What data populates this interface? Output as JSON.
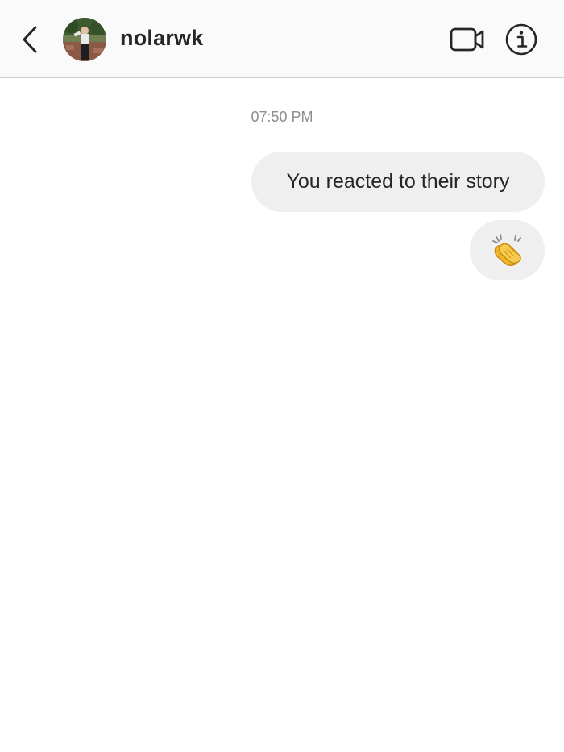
{
  "header": {
    "username": "nolarwk",
    "back_icon": "chevron-left-icon",
    "video_icon": "video-camera-icon",
    "info_icon": "info-icon"
  },
  "conversation": {
    "timestamp": "07:50 PM",
    "messages": [
      {
        "type": "story-reaction",
        "text": "You reacted to their story",
        "sender": "me"
      },
      {
        "type": "emoji",
        "emoji": "clapping-hands-emoji",
        "sender": "me"
      }
    ]
  },
  "colors": {
    "header_bg": "#fafafa",
    "bubble_bg": "#efefef",
    "text": "#262626",
    "muted": "#8e8e8e",
    "emoji_yellow": "#f5c43a"
  }
}
